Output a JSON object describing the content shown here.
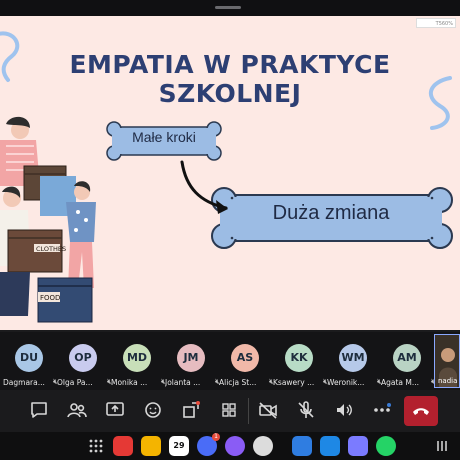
{
  "slide": {
    "title": "EMPATIA W PRAKTYCE SZKOLNEJ",
    "small_label": "Małe kroki",
    "big_label": "Duża zmiana",
    "box_labels": [
      "CLOTHES",
      "FOOD"
    ],
    "zoom_indicator": "T560%"
  },
  "participants": [
    {
      "initials": "DU",
      "name": "Dagmara...",
      "color": "#a9c7e6"
    },
    {
      "initials": "OP",
      "name": "Olga Pa...",
      "color": "#c9cbee"
    },
    {
      "initials": "MD",
      "name": "Monika ...",
      "color": "#c8dfb9"
    },
    {
      "initials": "JM",
      "name": "Jolanta ...",
      "color": "#e6bcc0"
    },
    {
      "initials": "AS",
      "name": "Alicja St...",
      "color": "#f1b9a9"
    },
    {
      "initials": "KK",
      "name": "Ksawery ...",
      "color": "#b8dcc6"
    },
    {
      "initials": "WM",
      "name": "Weronik...",
      "color": "#b6c9e9"
    },
    {
      "initials": "AM",
      "name": "Agata M...",
      "color": "#b9d3c4"
    }
  ],
  "self_view": {
    "name": "nadia"
  },
  "toolbar": {
    "items": [
      "chat-icon",
      "participants-icon",
      "share-screen-icon",
      "reactions-icon",
      "apps-icon",
      "view-grid-icon",
      "camera-off-icon",
      "mic-off-icon",
      "speaker-icon",
      "more-icon",
      "leave-icon"
    ]
  },
  "taskbar": {
    "calendar_date": "29",
    "messenger_badge": "1"
  }
}
